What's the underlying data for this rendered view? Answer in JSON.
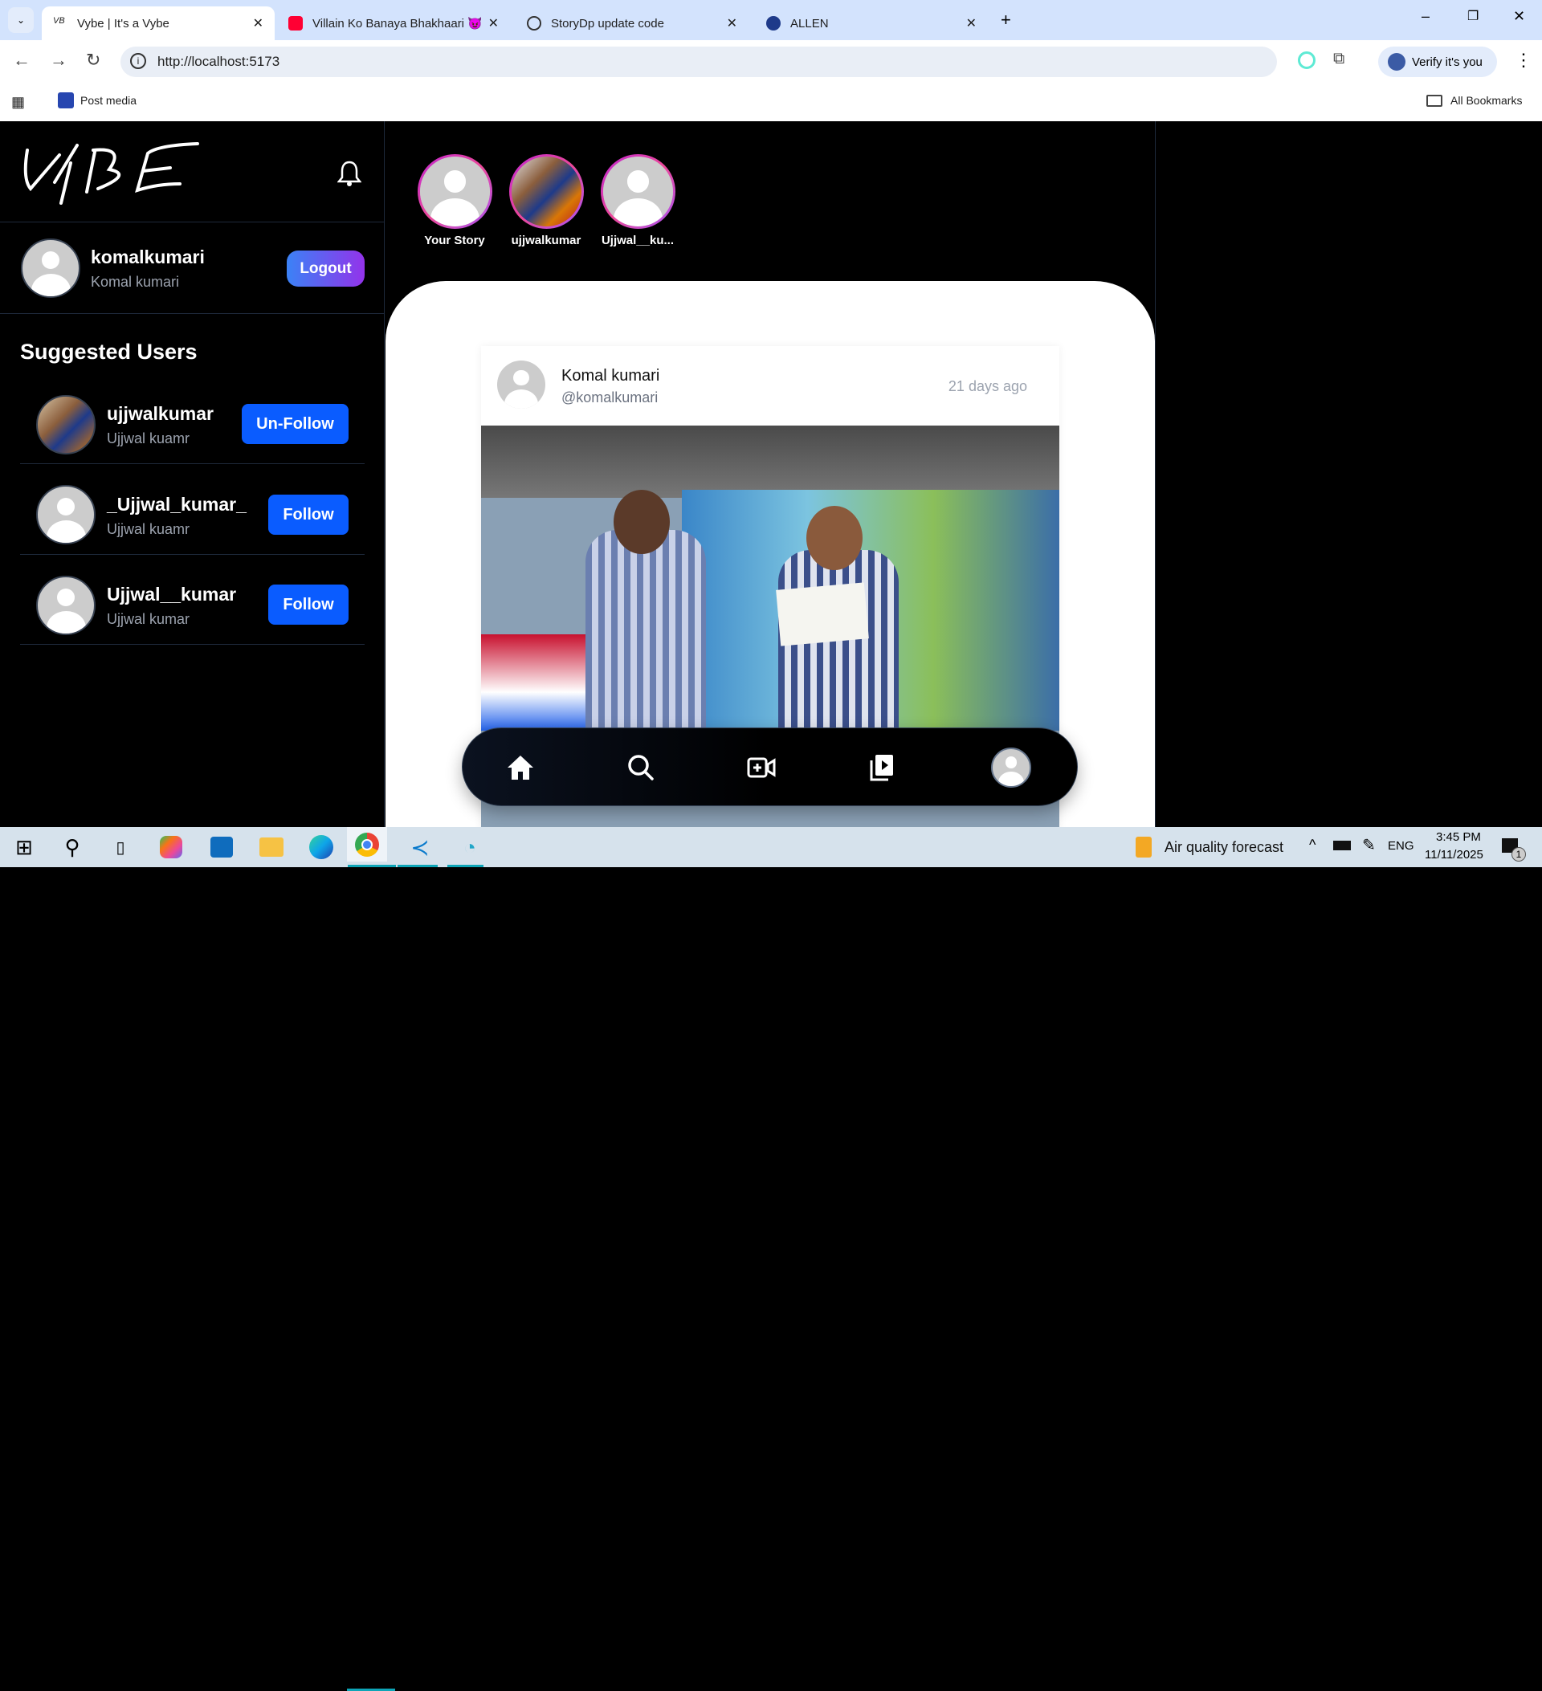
{
  "browser": {
    "tabs": [
      {
        "title": "Vybe | It's a Vybe",
        "active": true
      },
      {
        "title": "Villain Ko Banaya Bhakhaari 😈"
      },
      {
        "title": "StoryDp update code"
      },
      {
        "title": "ALLEN"
      }
    ],
    "url": "http://localhost:5173",
    "verify_label": "Verify it's you",
    "bookmarks": [
      {
        "label": "Post media"
      }
    ],
    "all_bookmarks": "All Bookmarks"
  },
  "app": {
    "logo": "VYBE",
    "current_user": {
      "username": "komalkumari",
      "name": "Komal kumari"
    },
    "logout_label": "Logout",
    "suggested_title": "Suggested Users",
    "suggested": [
      {
        "username": "ujjwalkumar",
        "name": "Ujjwal kuamr",
        "action": "Un-Follow"
      },
      {
        "username": "_Ujjwal_kumar_",
        "name": "Ujjwal kuamr",
        "action": "Follow"
      },
      {
        "username": "Ujjwal__kumar",
        "name": "Ujjwal kumar",
        "action": "Follow"
      }
    ],
    "stories": [
      {
        "label": "Your Story"
      },
      {
        "label": "ujjwalkumar"
      },
      {
        "label": "Ujjwal__ku..."
      }
    ],
    "post": {
      "name": "Komal kumari",
      "handle": "@komalkumari",
      "time": "21 days ago"
    }
  },
  "taskbar": {
    "weather": "Air quality forecast",
    "lang": "ENG",
    "time": "3:45 PM",
    "date": "11/11/2025",
    "notifications": "1"
  },
  "colors": {
    "follow": "#0a5cff",
    "logout_from": "#3b82f6",
    "logout_to": "#9333ea"
  }
}
